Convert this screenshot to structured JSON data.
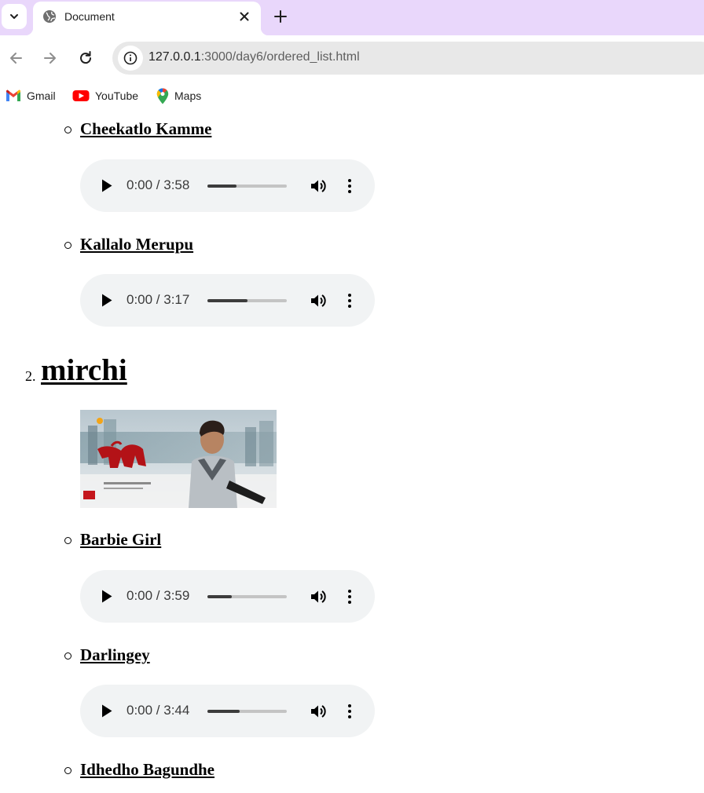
{
  "browser": {
    "tab": {
      "title": "Document"
    },
    "address": {
      "host": "127.0.0.1",
      "path": ":3000/day6/ordered_list.html"
    },
    "bookmarks": [
      {
        "label": "Gmail",
        "icon": "gmail-icon"
      },
      {
        "label": "YouTube",
        "icon": "youtube-icon"
      },
      {
        "label": "Maps",
        "icon": "maps-icon"
      }
    ],
    "colors": {
      "tabstrip": "#e9d7fb",
      "omnibox": "#e8e8e8",
      "player": "#f1f3f4"
    }
  },
  "content": {
    "songs_before": [
      {
        "title": "Cheekatlo Kamme",
        "time": "0:00 / 3:58",
        "buffered": 0.37
      },
      {
        "title": "Kallalo Merupu",
        "time": "0:00 / 3:17",
        "buffered": 0.5
      }
    ],
    "album": {
      "number": "2.",
      "title": "mirchi",
      "poster_icon": "movie-poster-image"
    },
    "songs_after": [
      {
        "title": "Barbie Girl",
        "time": "0:00 / 3:59",
        "buffered": 0.31
      },
      {
        "title": "Darlingey",
        "time": "0:00 / 3:44",
        "buffered": 0.41
      },
      {
        "title": "Idhedho Bagundhe"
      }
    ]
  }
}
